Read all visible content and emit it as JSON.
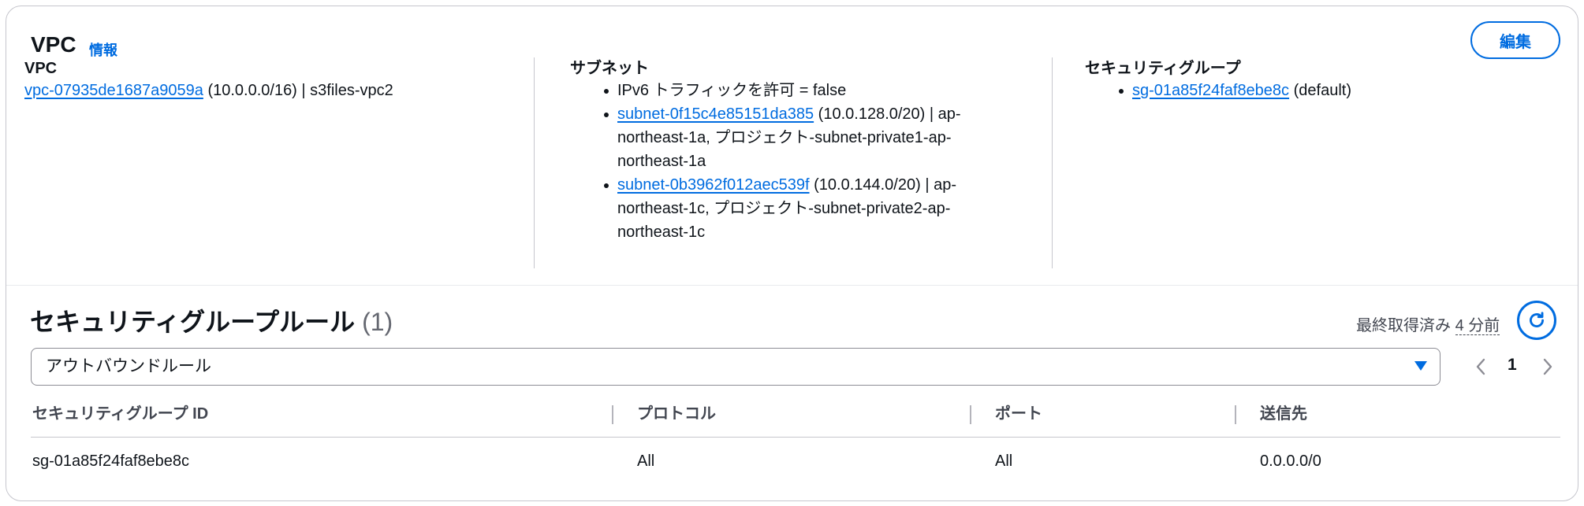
{
  "header": {
    "title": "VPC",
    "info_link": "情報",
    "edit_button": "編集"
  },
  "vpc_column": {
    "title": "VPC",
    "vpc_id": "vpc-07935de1687a9059a",
    "vpc_detail": "(10.0.0.0/16) | s3files-vpc2"
  },
  "subnet_column": {
    "title": "サブネット",
    "ipv6": "IPv6 トラフィックを許可 = false",
    "subnets": [
      {
        "id": "subnet-0f15c4e85151da385",
        "line1": " (10.0.128.0/20) | ap-",
        "line2": "northeast-1a, プロジェクト-subnet-private1-ap-",
        "line3": "northeast-1a"
      },
      {
        "id": "subnet-0b3962f012aec539f",
        "line1": " (10.0.144.0/20) | ap-",
        "line2": "northeast-1c, プロジェクト-subnet-private2-ap-",
        "line3": "northeast-1c"
      }
    ]
  },
  "sg_column": {
    "title": "セキュリティグループ",
    "sg_id": "sg-01a85f24faf8ebe8c",
    "sg_detail": " (default)"
  },
  "rules": {
    "title": "セキュリティグループルール",
    "count": "(1)",
    "last_fetched_label": "最終取得済み",
    "last_fetched_value": "4 分前",
    "filter_selected": "アウトバウンドルール",
    "page": "1",
    "columns": [
      "セキュリティグループ ID",
      "プロトコル",
      "ポート",
      "送信先"
    ],
    "rows": [
      [
        "sg-01a85f24faf8ebe8c",
        "All",
        "All",
        "0.0.0.0/0"
      ]
    ]
  },
  "icons": {
    "refresh": "refresh-icon",
    "caret": "caret-down-icon",
    "prev": "chevron-left-icon",
    "next": "chevron-right-icon"
  },
  "colors": {
    "accent": "#006ce0",
    "text": "#0f141a",
    "border": "#c6c6cd",
    "disabled": "#8c8c94"
  }
}
